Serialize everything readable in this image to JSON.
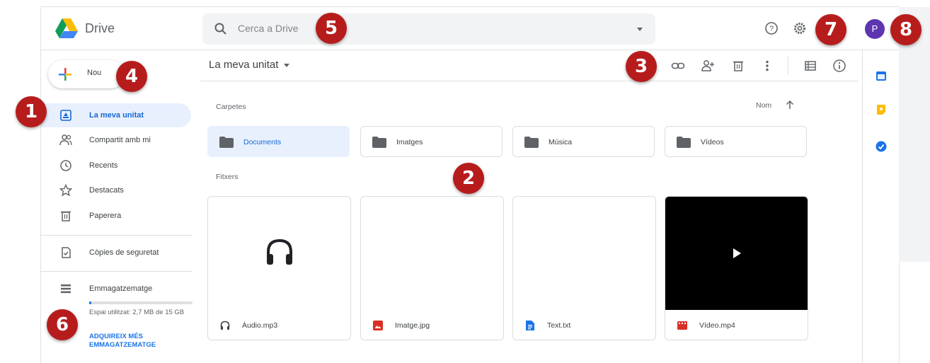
{
  "app": {
    "name": "Drive"
  },
  "search": {
    "placeholder": "Cerca a Drive"
  },
  "header": {
    "avatar_initial": "P"
  },
  "sidebar": {
    "new_label": "Nou",
    "items": [
      {
        "label": "La meva unitat",
        "icon": "my-drive-icon",
        "active": true
      },
      {
        "label": "Compartit amb mi",
        "icon": "shared-icon"
      },
      {
        "label": "Recents",
        "icon": "clock-icon"
      },
      {
        "label": "Destacats",
        "icon": "star-icon"
      },
      {
        "label": "Paperera",
        "icon": "trash-icon"
      },
      {
        "label": "Còpies de seguretat",
        "icon": "backup-icon"
      },
      {
        "label": "Emmagatzematge",
        "icon": "storage-icon"
      }
    ],
    "storage_used": "Espai utilitzat: 2,7 MB de 15 GB",
    "storage_fraction": 0.02,
    "buy_storage": "ADQUIREIX MÉS EMMAGATZEMATGE"
  },
  "main": {
    "breadcrumb": "La meva unitat",
    "folders_label": "Carpetes",
    "sort_label": "Nom",
    "folders": [
      {
        "name": "Documents",
        "selected": true
      },
      {
        "name": "Imatges"
      },
      {
        "name": "Música"
      },
      {
        "name": "Vídeos"
      }
    ],
    "files_label": "Fitxers",
    "files": [
      {
        "name": "Àudio.mp3",
        "type": "audio"
      },
      {
        "name": "Imatge.jpg",
        "type": "image"
      },
      {
        "name": "Text.txt",
        "type": "doc"
      },
      {
        "name": "Vídeo.mp4",
        "type": "video"
      }
    ]
  },
  "badges": [
    "1",
    "2",
    "3",
    "4",
    "5",
    "6",
    "7",
    "8"
  ],
  "colors": {
    "accent": "#1a73e8",
    "selected_bg": "#e8f0fe",
    "badge": "#b71c1c",
    "avatar": "#5e35b1"
  }
}
